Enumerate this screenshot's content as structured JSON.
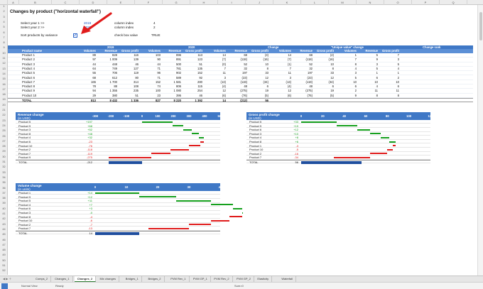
{
  "columns": [
    "A",
    "B",
    "C",
    "D",
    "E",
    "F",
    "G",
    "H",
    "I",
    "J",
    "K",
    "L",
    "M",
    "N",
    "O",
    "P",
    "Q"
  ],
  "title": "Changes by product (\"horizontal waterfall\")",
  "settings": [
    {
      "label": "Select year 1 >>",
      "value": "2019",
      "key": "column index",
      "num": "4"
    },
    {
      "label": "Select year 2 >>",
      "value": "2020",
      "key": "column index",
      "num": "2"
    }
  ],
  "sort_label": "Sort products by variance",
  "check_label": "check box value",
  "check_value": "TRUE",
  "check_mark": "✓",
  "table": {
    "groups": [
      "2019",
      "2020",
      "Change",
      "\"Unique value\" change",
      "Change rank"
    ],
    "headers": [
      "Product name",
      "Volumes",
      "Revenue",
      "Gross profit",
      "Volumes",
      "Revenue",
      "Gross profit",
      "Volumes",
      "Revenue",
      "Gross profit",
      "Volumes",
      "Revenue",
      "Gross profit",
      "Volumes",
      "Revenue",
      "Gross profit"
    ],
    "rows": [
      [
        "Product 1",
        "89",
        "828",
        "116",
        "103",
        "896",
        "113",
        "14",
        "68",
        "(3)",
        "14",
        "68",
        "(2)",
        "1",
        "5",
        "7"
      ],
      [
        "Product 2",
        "97",
        "1 009",
        "139",
        "90",
        "891",
        "123",
        "(7)",
        "(118)",
        "(16)",
        "(7)",
        "(118)",
        "(16)",
        "7",
        "9",
        "3"
      ],
      [
        "Product 3",
        "44",
        "448",
        "46",
        "44",
        "500",
        "51",
        "(0)",
        "52",
        "10",
        "(1)",
        "52",
        "10",
        "8",
        "3",
        "5"
      ],
      [
        "Product 4",
        "64",
        "749",
        "127",
        "71",
        "781",
        "135",
        "7",
        "32",
        "8",
        "7",
        "32",
        "8",
        "4",
        "5",
        "4"
      ],
      [
        "Product 5",
        "55",
        "706",
        "119",
        "96",
        "902",
        "152",
        "11",
        "197",
        "33",
        "11",
        "197",
        "33",
        "3",
        "1",
        "1"
      ],
      [
        "Product 6",
        "68",
        "612",
        "80",
        "71",
        "589",
        "92",
        "3",
        "(23)",
        "12",
        "3",
        "(23)",
        "12",
        "5",
        "6",
        "2"
      ],
      [
        "Product 7",
        "165",
        "1 700",
        "314",
        "152",
        "1 581",
        "280",
        "(13)",
        "(119)",
        "(34)",
        "(13)",
        "(119)",
        "(34)",
        "10",
        "10",
        "10"
      ],
      [
        "Product 8",
        "78",
        "88",
        "108",
        "74",
        "806",
        "115",
        "(4)",
        "48",
        "6",
        "(4)",
        "48",
        "6",
        "6",
        "4",
        "6"
      ],
      [
        "Product 9",
        "94",
        "1 355",
        "235",
        "100",
        "1 080",
        "254",
        "12",
        "(275)",
        "19",
        "12",
        "(275)",
        "19",
        "2",
        "11",
        "11"
      ],
      [
        "Product 10",
        "29",
        "380",
        "51",
        "23",
        "395",
        "46",
        "(6)",
        "(76)",
        "(5)",
        "(6)",
        "(76)",
        "(5)",
        "9",
        "8",
        "8"
      ]
    ],
    "total": [
      "TOTAL",
      "813",
      "8 432",
      "1 336",
      "827",
      "8 220",
      "1 392",
      "14",
      "(212)",
      "56",
      "",
      "",
      "",
      "",
      "",
      ""
    ]
  },
  "charts": {
    "revenue": {
      "title": "Revenue change",
      "unit": "(in USD)",
      "ticks": [
        "-300",
        "-200",
        "-100",
        "0",
        "100",
        "200",
        "300",
        "400",
        "500"
      ],
      "rows": [
        [
          "Product 5",
          "+197"
        ],
        [
          "Product 9",
          "+68"
        ],
        [
          "Product 3",
          "+52"
        ],
        [
          "Product 8",
          "+48"
        ],
        [
          "Product 4",
          "+32"
        ],
        [
          "Product 6",
          "-23"
        ],
        [
          "Product 10",
          "-76"
        ],
        [
          "Product 2",
          "-118"
        ],
        [
          "Product 7",
          "-119"
        ],
        [
          "Product 9",
          "-275"
        ]
      ],
      "total": [
        "TOTAL",
        "-212"
      ]
    },
    "gross": {
      "title": "Gross profit change",
      "unit": "(in USD)",
      "ticks": [
        "0",
        "20",
        "40",
        "60",
        "80",
        "100",
        "120"
      ],
      "rows": [
        [
          "Product 5",
          "+33"
        ],
        [
          "Product 9",
          "+19"
        ],
        [
          "Product 6",
          "+12"
        ],
        [
          "Product 3",
          "+10"
        ],
        [
          "Product 4",
          "+8"
        ],
        [
          "Product 8",
          "+6"
        ],
        [
          "Product 1",
          "-3"
        ],
        [
          "Product 10",
          "-5"
        ],
        [
          "Product 2",
          "-16"
        ],
        [
          "Product 7",
          "-34"
        ]
      ],
      "total": [
        "TOTAL",
        "56"
      ]
    },
    "volume": {
      "title": "Volume change",
      "unit": "(in units)",
      "ticks": [
        "0",
        "10",
        "20",
        "30",
        "40"
      ],
      "rows": [
        [
          "Product 1",
          "+14"
        ],
        [
          "Product 9",
          "+12"
        ],
        [
          "Product 5",
          "+11"
        ],
        [
          "Product 4",
          "+7"
        ],
        [
          "Product 6",
          "+3"
        ],
        [
          "Product 3",
          "-0"
        ],
        [
          "Product 8",
          "-4"
        ],
        [
          "Product 10",
          "-6"
        ],
        [
          "Product 2",
          "-7"
        ],
        [
          "Product 7",
          "-13"
        ]
      ],
      "total": [
        "TOTAL",
        "14"
      ]
    }
  },
  "colors": {
    "positive": "#16a01e",
    "negative": "#e01b1b",
    "total": "#1f4e9e",
    "header": "#3f78c6"
  },
  "tabs": [
    "Comps_2",
    "Changes_1",
    "Changes_2",
    "Mix changes",
    "Bridges_1",
    "Bridges_2",
    "PVM Rev_1",
    "PVM GP_1",
    "PVM Rev_2",
    "PVM GP_2",
    "Elasticity",
    "Waterfall"
  ],
  "active_tab": "Changes_2",
  "status": {
    "view": "Normal View",
    "ready": "Ready",
    "sum": "Sum=0"
  }
}
